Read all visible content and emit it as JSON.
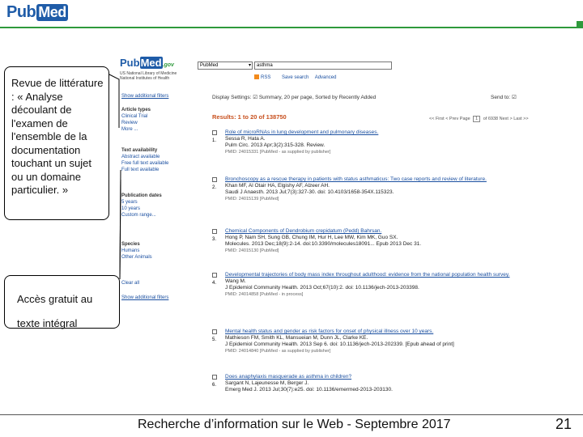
{
  "slide": {
    "logo_pub": "Pub",
    "logo_med": "Med",
    "footer": "Recherche d’information sur le Web - Septembre 2017",
    "page_number": "21",
    "accent_color": "#2e9a3c"
  },
  "callouts": {
    "review": "Revue de littérature : « Analyse découlant de l'examen de l'ensemble de la documentation touchant un sujet ou un domaine particulier. »",
    "free_full_text_line1": "Accès gratuit au",
    "free_full_text_line2": "texte intégral"
  },
  "screenshot": {
    "logo_pub": "Pub",
    "logo_med": "Med",
    "logo_gov": ".gov",
    "subtitle": "US National Library of Medicine National Institutes of Health",
    "db_select": "PubMed",
    "search_query": "asthma",
    "rss": "RSS",
    "save_search": "Save search",
    "advanced": "Advanced",
    "show_additional_filters": "Show additional filters",
    "filters": [
      {
        "title": "Article types",
        "items": [
          "Clinical Trial",
          "Review",
          "More ..."
        ]
      },
      {
        "title": "Text availability",
        "items": [
          "Abstract available",
          "Free full text available",
          "Full text available"
        ]
      },
      {
        "title": "Publication dates",
        "items": [
          "5 years",
          "10 years",
          "Custom range..."
        ]
      },
      {
        "title": "Species",
        "items": [
          "Humans",
          "Other Animals"
        ]
      }
    ],
    "clear_all": "Clear all",
    "show_additional_filters_bottom": "Show additional filters",
    "display_settings": "Display Settings: ☑ Summary, 20 per page, Sorted by Recently Added",
    "send_to": "Send to: ☑",
    "results_count": "Results: 1 to 20 of 138750",
    "pager": {
      "first": "<< First",
      "prev": "< Prev",
      "page_label": "Page",
      "page": "1",
      "of": "of 6938",
      "next": "Next >",
      "last": "Last >>"
    },
    "results": [
      {
        "num": "1.",
        "title": "Role of microRNAs in lung development and pulmonary diseases.",
        "authors": "Sessa R, Hata A.",
        "journal": "Pulm Circ. 2013 Apr;3(2):315-328. Review.",
        "pmid": "PMID: 24015331 [PubMed - as supplied by publisher]"
      },
      {
        "num": "2.",
        "title": "Bronchoscopy as a rescue therapy in patients with status asthmaticus: Two case reports and review of literature.",
        "authors": "Khan MF, Al Otair HA, Elgishy AF, Alzeer AH.",
        "journal": "Saudi J Anaesth. 2013 Jul;7(3):327-30. doi: 10.4103/1658-354X.115323.",
        "pmid": "PMID: 24015139 [PubMed]"
      },
      {
        "num": "3.",
        "title": "Chemical Components of Dendrobium crepidatum (Pedd) Bahrsan.",
        "authors": "Hong P, Nam SH, Sung GB, Chung IM, Hur H, Lee MW, Kim MK, Guo SX.",
        "journal": "Molecules. 2013 Dec;18(9):2-14. doi:10.3390/molecules18091... Epub 2013 Dec 31.",
        "pmid": "PMID: 24015130 [PubMed]"
      },
      {
        "num": "4.",
        "title": "Developmental trajectories of body mass index throughout adulthood: evidence from the national population health survey.",
        "authors": "Wang M.",
        "journal": "J Epidemiol Community Health. 2013 Oct;67(10):2. doi: 10.1136/jech-2013-203398.",
        "pmid": "PMID: 24014858 [PubMed - in process]"
      },
      {
        "num": "5.",
        "title": "Mental health status and gender as risk factors for onset of physical illness over 10 years.",
        "authors": "Mathieson FM, Smith KL, Mansueian M, Dunn JL, Clarke KE.",
        "journal": "J Epidemiol Community Health. 2013 Sep 6. doi: 10.1136/jech-2013-202339. [Epub ahead of print]",
        "pmid": "PMID: 24014840 [PubMed - as supplied by publisher]"
      },
      {
        "num": "6.",
        "title": "Does anaphylaxis masquerade as asthma in children?",
        "authors": "Sargant N, Lajeunesse M, Berger J.",
        "journal": "Emerg Med J. 2013 Jul;30(7):e25. doi: 10.1136/emermed-2013-203130.",
        "pmid": ""
      }
    ]
  }
}
